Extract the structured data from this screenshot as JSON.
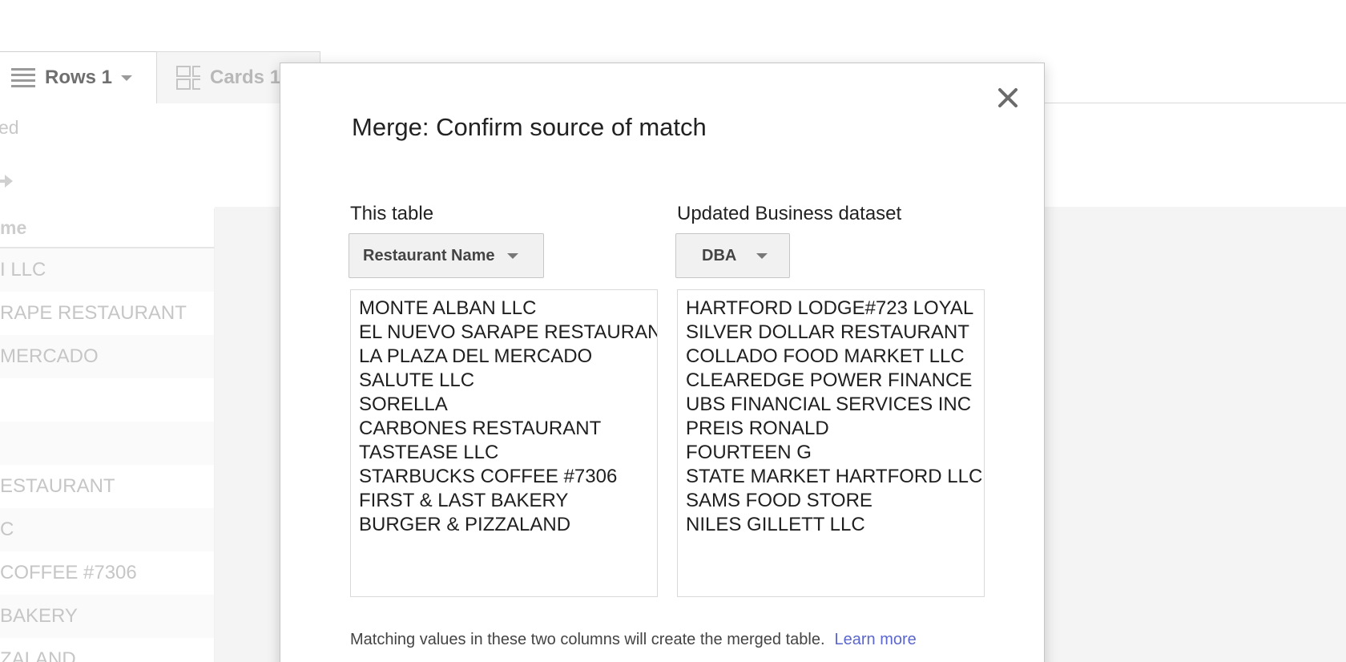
{
  "background": {
    "tabs": {
      "rows_label": "Rows 1",
      "cards_label": "Cards 1"
    },
    "status_fragment": "ed",
    "table": {
      "header": "me",
      "rows": [
        "I LLC",
        "RAPE RESTAURANT",
        "MERCADO",
        "",
        "",
        "ESTAURANT",
        "C",
        "COFFEE #7306",
        "BAKERY",
        "ZALAND"
      ]
    }
  },
  "modal": {
    "title": "Merge: Confirm source of match",
    "left": {
      "label": "This table",
      "selected_column": "Restaurant Name",
      "values": [
        "MONTE ALBAN LLC",
        "EL NUEVO SARAPE RESTAURANT",
        "LA PLAZA DEL MERCADO",
        "SALUTE LLC",
        "SORELLA",
        "CARBONES RESTAURANT",
        "TASTEASE LLC",
        "STARBUCKS COFFEE #7306",
        "FIRST & LAST BAKERY",
        "BURGER & PIZZALAND"
      ]
    },
    "right": {
      "label": "Updated Business dataset",
      "selected_column": "DBA",
      "values": [
        "HARTFORD LODGE#723 LOYAL",
        "SILVER DOLLAR RESTAURANT",
        "COLLADO FOOD MARKET LLC",
        "CLEAREDGE POWER FINANCE",
        "UBS FINANCIAL SERVICES INC",
        "PREIS RONALD",
        "FOURTEEN G",
        "STATE MARKET HARTFORD LLC",
        "SAMS FOOD STORE",
        "NILES GILLETT LLC"
      ]
    },
    "footer": {
      "text": "Matching values in these two columns will create the merged table.",
      "link": "Learn more"
    }
  },
  "colors": {
    "link": "#5b67cc",
    "title": "#222222",
    "dropdown_bg": "#f1f1f1"
  }
}
